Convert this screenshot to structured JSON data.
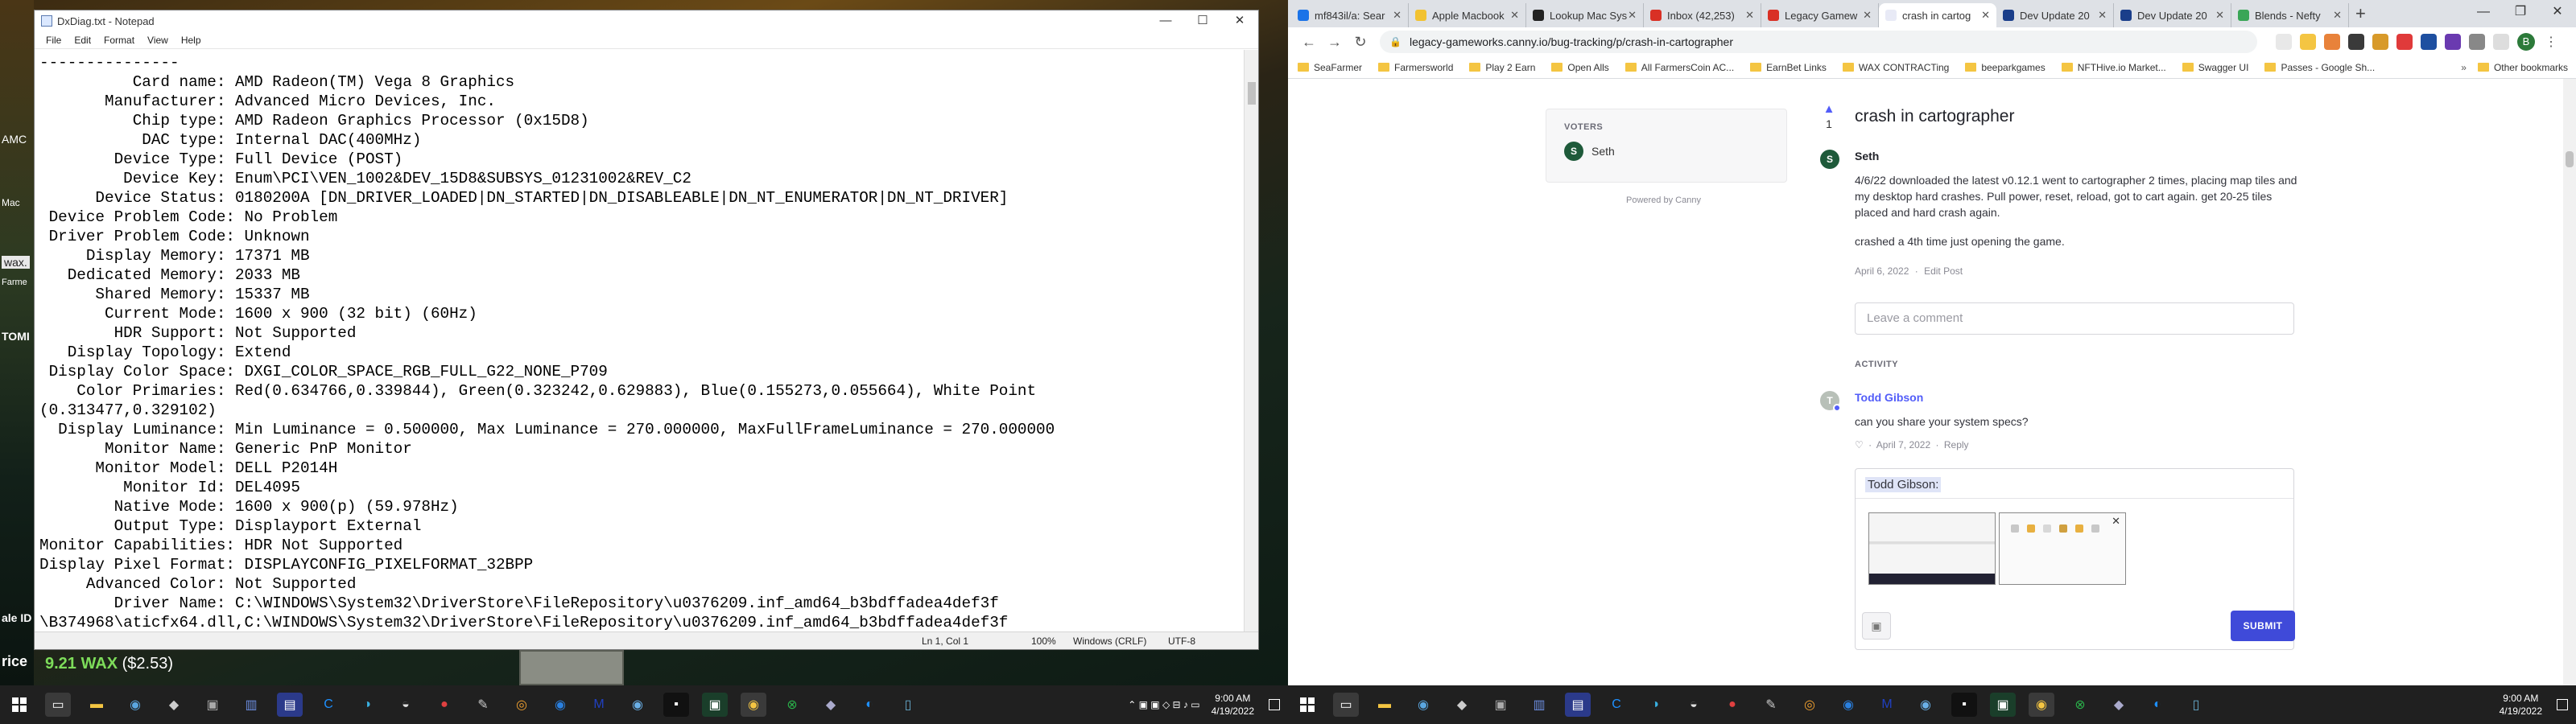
{
  "desktop": {
    "left_fragments": [
      {
        "text": "AMC"
      },
      {
        "text": "Mac"
      },
      {
        "text": "wax."
      },
      {
        "text": "Farme"
      },
      {
        "text": "TOMI"
      },
      {
        "text": "ale ID"
      },
      {
        "text": "rice"
      }
    ],
    "wax_price": "9.21 WAX",
    "usd_price": "($2.53)"
  },
  "notepad": {
    "title": "DxDiag.txt - Notepad",
    "menu": [
      "File",
      "Edit",
      "Format",
      "View",
      "Help"
    ],
    "lines": [
      "---------------",
      "          Card name: AMD Radeon(TM) Vega 8 Graphics",
      "       Manufacturer: Advanced Micro Devices, Inc.",
      "          Chip type: AMD Radeon Graphics Processor (0x15D8)",
      "           DAC type: Internal DAC(400MHz)",
      "        Device Type: Full Device (POST)",
      "         Device Key: Enum\\PCI\\VEN_1002&DEV_15D8&SUBSYS_01231002&REV_C2",
      "      Device Status: 0180200A [DN_DRIVER_LOADED|DN_STARTED|DN_DISABLEABLE|DN_NT_ENUMERATOR|DN_NT_DRIVER]",
      " Device Problem Code: No Problem",
      " Driver Problem Code: Unknown",
      "     Display Memory: 17371 MB",
      "   Dedicated Memory: 2033 MB",
      "      Shared Memory: 15337 MB",
      "       Current Mode: 1600 x 900 (32 bit) (60Hz)",
      "        HDR Support: Not Supported",
      "   Display Topology: Extend",
      " Display Color Space: DXGI_COLOR_SPACE_RGB_FULL_G22_NONE_P709",
      "    Color Primaries: Red(0.634766,0.339844), Green(0.323242,0.629883), Blue(0.155273,0.055664), White Point",
      "(0.313477,0.329102)",
      "  Display Luminance: Min Luminance = 0.500000, Max Luminance = 270.000000, MaxFullFrameLuminance = 270.000000",
      "       Monitor Name: Generic PnP Monitor",
      "      Monitor Model: DELL P2014H",
      "         Monitor Id: DEL4095",
      "        Native Mode: 1600 x 900(p) (59.978Hz)",
      "        Output Type: Displayport External",
      "Monitor Capabilities: HDR Not Supported",
      "Display Pixel Format: DISPLAYCONFIG_PIXELFORMAT_32BPP",
      "     Advanced Color: Not Supported",
      "        Driver Name: C:\\WINDOWS\\System32\\DriverStore\\FileRepository\\u0376209.inf_amd64_b3bdffadea4def3f",
      "\\B374968\\aticfx64.dll,C:\\WINDOWS\\System32\\DriverStore\\FileRepository\\u0376209.inf_amd64_b3bdffadea4def3f"
    ],
    "status": {
      "position": "Ln 1, Col 1",
      "zoom": "100%",
      "line_ending": "Windows (CRLF)",
      "encoding": "UTF-8"
    }
  },
  "taskbar": {
    "time": "9:00 AM",
    "date": "4/19/2022"
  },
  "browser": {
    "tabs": [
      {
        "label": "mf843il/a: Sear",
        "color": "#1a73e8"
      },
      {
        "label": "Apple Macbook",
        "color": "#f2c230"
      },
      {
        "label": "Lookup Mac Sys",
        "color": "#222222"
      },
      {
        "label": "Inbox (42,253)",
        "color": "#d93025"
      },
      {
        "label": "Legacy Gamew",
        "color": "#d93025"
      },
      {
        "label": "crash in cartog",
        "color": "#e8eaf6"
      },
      {
        "label": "Dev Update 20",
        "color": "#1a3e8a"
      },
      {
        "label": "Dev Update 20",
        "color": "#1a3e8a"
      },
      {
        "label": "Blends - Nefty",
        "color": "#3aa657"
      }
    ],
    "active_tab": 5,
    "url": "legacy-gameworks.canny.io/bug-tracking/p/crash-in-cartographer",
    "bookmarks": [
      "SeaFarmer",
      "Farmersworld",
      "Play 2 Earn",
      "Open Alls",
      "All FarmersCoin AC...",
      "EarnBet Links",
      "WAX CONTRACTing",
      "beeparkgames",
      "NFTHive.io Market...",
      "Swagger UI",
      "Passes - Google Sh..."
    ],
    "other_bookmarks": "Other bookmarks",
    "profile_initial": "B"
  },
  "page": {
    "voters_heading": "VOTERS",
    "voter": {
      "name": "Seth",
      "initial": "S"
    },
    "powered_by": "Powered by Canny",
    "vote_count": "1",
    "post_title": "crash in cartographer",
    "author": "Seth",
    "author_initial": "S",
    "body": [
      "4/6/22 downloaded the latest v0.12.1 went to cartographer 2 times, placing map tiles and my desktop hard crashes. Pull power, reset, reload, got to cart again. get 20-25 tiles placed and hard crash again.",
      "crashed a 4th time just opening the game."
    ],
    "post_date": "April 6, 2022",
    "edit_post": "Edit Post",
    "comment_placeholder": "Leave a comment",
    "activity_heading": "ACTIVITY",
    "commenter": "Todd Gibson",
    "commenter_initial": "T",
    "comment_text": "can you share your system specs?",
    "comment_date": "April 7, 2022",
    "reply_link": "Reply",
    "mention": "Todd Gibson:",
    "submit_label": "SUBMIT",
    "colors": {
      "accent": "#525df9",
      "submit": "#3f4ad9"
    }
  }
}
